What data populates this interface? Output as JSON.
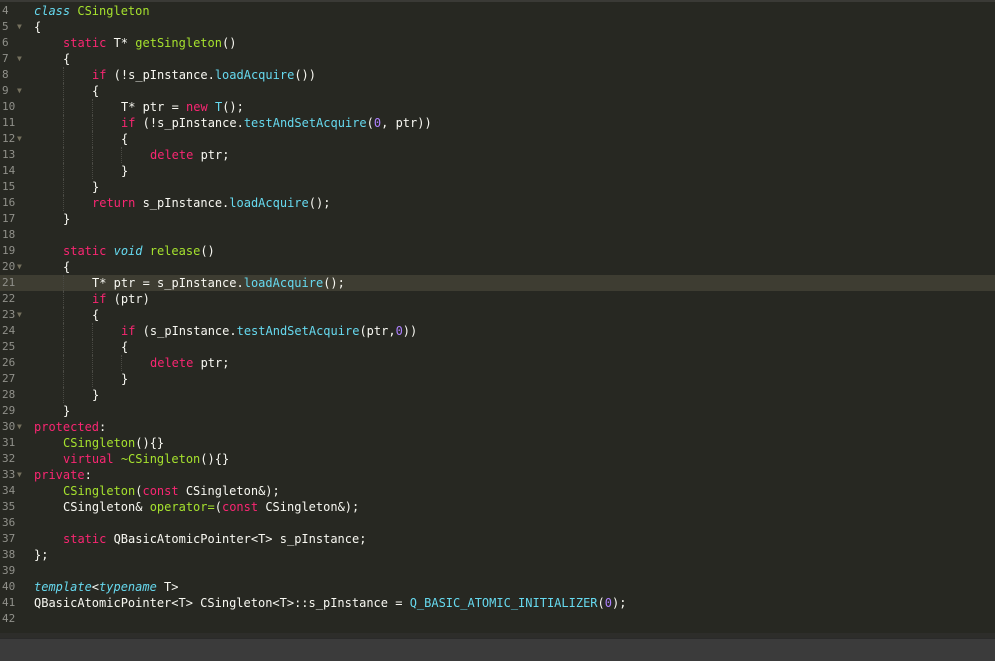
{
  "editor": {
    "theme": "monokai",
    "current_line": "21",
    "colors": {
      "background": "#272822",
      "plain": "#f8f8f2",
      "keyword": "#f92672",
      "type": "#66d9ef",
      "function": "#a6e22e",
      "number": "#ae81ff",
      "line_number": "#90908a"
    },
    "lines": [
      {
        "num": "4",
        "indent": 0,
        "fold": false,
        "tokens": [
          {
            "t": "class",
            "c": "ty"
          },
          {
            "t": " ",
            "c": "pl"
          },
          {
            "t": "CSingleton",
            "c": "cl"
          }
        ]
      },
      {
        "num": "5",
        "indent": 0,
        "fold": true,
        "tokens": [
          {
            "t": "{",
            "c": "pl"
          }
        ]
      },
      {
        "num": "6",
        "indent": 1,
        "fold": false,
        "tokens": [
          {
            "t": "static",
            "c": "kw"
          },
          {
            "t": " T* ",
            "c": "pl"
          },
          {
            "t": "getSingleton",
            "c": "fn"
          },
          {
            "t": "()",
            "c": "pl"
          }
        ]
      },
      {
        "num": "7",
        "indent": 1,
        "fold": true,
        "tokens": [
          {
            "t": "{",
            "c": "pl"
          }
        ]
      },
      {
        "num": "8",
        "indent": 2,
        "fold": false,
        "tokens": [
          {
            "t": "if",
            "c": "kw"
          },
          {
            "t": " (!s_pInstance.",
            "c": "pl"
          },
          {
            "t": "loadAcquire",
            "c": "cn"
          },
          {
            "t": "())",
            "c": "pl"
          }
        ]
      },
      {
        "num": "9",
        "indent": 2,
        "fold": true,
        "tokens": [
          {
            "t": "{",
            "c": "pl"
          }
        ]
      },
      {
        "num": "10",
        "indent": 3,
        "fold": false,
        "tokens": [
          {
            "t": "T* ptr = ",
            "c": "pl"
          },
          {
            "t": "new",
            "c": "kw"
          },
          {
            "t": " ",
            "c": "pl"
          },
          {
            "t": "T",
            "c": "cn"
          },
          {
            "t": "();",
            "c": "pl"
          }
        ]
      },
      {
        "num": "11",
        "indent": 3,
        "fold": false,
        "tokens": [
          {
            "t": "if",
            "c": "kw"
          },
          {
            "t": " (!s_pInstance.",
            "c": "pl"
          },
          {
            "t": "testAndSetAcquire",
            "c": "cn"
          },
          {
            "t": "(",
            "c": "pl"
          },
          {
            "t": "0",
            "c": "nu"
          },
          {
            "t": ", ptr))",
            "c": "pl"
          }
        ]
      },
      {
        "num": "12",
        "indent": 3,
        "fold": true,
        "tokens": [
          {
            "t": "{",
            "c": "pl"
          }
        ]
      },
      {
        "num": "13",
        "indent": 4,
        "fold": false,
        "tokens": [
          {
            "t": "delete",
            "c": "kw"
          },
          {
            "t": " ptr;",
            "c": "pl"
          }
        ]
      },
      {
        "num": "14",
        "indent": 3,
        "fold": false,
        "tokens": [
          {
            "t": "}",
            "c": "pl"
          }
        ]
      },
      {
        "num": "15",
        "indent": 2,
        "fold": false,
        "tokens": [
          {
            "t": "}",
            "c": "pl"
          }
        ]
      },
      {
        "num": "16",
        "indent": 2,
        "fold": false,
        "tokens": [
          {
            "t": "return",
            "c": "kw"
          },
          {
            "t": " s_pInstance.",
            "c": "pl"
          },
          {
            "t": "loadAcquire",
            "c": "cn"
          },
          {
            "t": "();",
            "c": "pl"
          }
        ]
      },
      {
        "num": "17",
        "indent": 1,
        "fold": false,
        "tokens": [
          {
            "t": "}",
            "c": "pl"
          }
        ]
      },
      {
        "num": "18",
        "indent": 0,
        "fold": false,
        "tokens": []
      },
      {
        "num": "19",
        "indent": 1,
        "fold": false,
        "tokens": [
          {
            "t": "static",
            "c": "kw"
          },
          {
            "t": " ",
            "c": "pl"
          },
          {
            "t": "void",
            "c": "ty"
          },
          {
            "t": " ",
            "c": "pl"
          },
          {
            "t": "release",
            "c": "fn"
          },
          {
            "t": "()",
            "c": "pl"
          }
        ]
      },
      {
        "num": "20",
        "indent": 1,
        "fold": true,
        "tokens": [
          {
            "t": "{",
            "c": "pl"
          }
        ]
      },
      {
        "num": "21",
        "indent": 2,
        "fold": false,
        "tokens": [
          {
            "t": "T* ptr = s_pInstance.",
            "c": "pl"
          },
          {
            "t": "loadAcquire",
            "c": "cn"
          },
          {
            "t": "();",
            "c": "pl"
          }
        ]
      },
      {
        "num": "22",
        "indent": 2,
        "fold": false,
        "tokens": [
          {
            "t": "if",
            "c": "kw"
          },
          {
            "t": " (ptr)",
            "c": "pl"
          }
        ]
      },
      {
        "num": "23",
        "indent": 2,
        "fold": true,
        "tokens": [
          {
            "t": "{",
            "c": "pl"
          }
        ]
      },
      {
        "num": "24",
        "indent": 3,
        "fold": false,
        "tokens": [
          {
            "t": "if",
            "c": "kw"
          },
          {
            "t": " (s_pInstance.",
            "c": "pl"
          },
          {
            "t": "testAndSetAcquire",
            "c": "cn"
          },
          {
            "t": "(ptr,",
            "c": "pl"
          },
          {
            "t": "0",
            "c": "nu"
          },
          {
            "t": "))",
            "c": "pl"
          }
        ]
      },
      {
        "num": "25",
        "indent": 3,
        "fold": false,
        "tokens": [
          {
            "t": "{",
            "c": "pl"
          }
        ]
      },
      {
        "num": "26",
        "indent": 4,
        "fold": false,
        "tokens": [
          {
            "t": "delete",
            "c": "kw"
          },
          {
            "t": " ptr;",
            "c": "pl"
          }
        ]
      },
      {
        "num": "27",
        "indent": 3,
        "fold": false,
        "tokens": [
          {
            "t": "}",
            "c": "pl"
          }
        ]
      },
      {
        "num": "28",
        "indent": 2,
        "fold": false,
        "tokens": [
          {
            "t": "}",
            "c": "pl"
          }
        ]
      },
      {
        "num": "29",
        "indent": 1,
        "fold": false,
        "tokens": [
          {
            "t": "}",
            "c": "pl"
          }
        ]
      },
      {
        "num": "30",
        "indent": 0,
        "fold": true,
        "tokens": [
          {
            "t": "protected",
            "c": "kw"
          },
          {
            "t": ":",
            "c": "pl"
          }
        ]
      },
      {
        "num": "31",
        "indent": 1,
        "fold": false,
        "tokens": [
          {
            "t": "CSingleton",
            "c": "fn"
          },
          {
            "t": "(){}",
            "c": "pl"
          }
        ]
      },
      {
        "num": "32",
        "indent": 1,
        "fold": false,
        "tokens": [
          {
            "t": "virtual",
            "c": "kw"
          },
          {
            "t": " ",
            "c": "pl"
          },
          {
            "t": "~CSingleton",
            "c": "fn"
          },
          {
            "t": "(){}",
            "c": "pl"
          }
        ]
      },
      {
        "num": "33",
        "indent": 0,
        "fold": true,
        "tokens": [
          {
            "t": "private",
            "c": "kw"
          },
          {
            "t": ":",
            "c": "pl"
          }
        ]
      },
      {
        "num": "34",
        "indent": 1,
        "fold": false,
        "tokens": [
          {
            "t": "CSingleton",
            "c": "fn"
          },
          {
            "t": "(",
            "c": "pl"
          },
          {
            "t": "const",
            "c": "kw"
          },
          {
            "t": " CSingleton&);",
            "c": "pl"
          }
        ]
      },
      {
        "num": "35",
        "indent": 1,
        "fold": false,
        "tokens": [
          {
            "t": "CSingleton& ",
            "c": "pl"
          },
          {
            "t": "operator=",
            "c": "fn"
          },
          {
            "t": "(",
            "c": "pl"
          },
          {
            "t": "const",
            "c": "kw"
          },
          {
            "t": " CSingleton&);",
            "c": "pl"
          }
        ]
      },
      {
        "num": "36",
        "indent": 0,
        "fold": false,
        "tokens": []
      },
      {
        "num": "37",
        "indent": 1,
        "fold": false,
        "tokens": [
          {
            "t": "static",
            "c": "kw"
          },
          {
            "t": " QBasicAtomicPointer<T> s_pInstance;",
            "c": "pl"
          }
        ]
      },
      {
        "num": "38",
        "indent": 0,
        "fold": false,
        "tokens": [
          {
            "t": "};",
            "c": "pl"
          }
        ]
      },
      {
        "num": "39",
        "indent": 0,
        "fold": false,
        "tokens": []
      },
      {
        "num": "40",
        "indent": 0,
        "fold": false,
        "tokens": [
          {
            "t": "template",
            "c": "ty"
          },
          {
            "t": "<",
            "c": "pl"
          },
          {
            "t": "typename",
            "c": "ty"
          },
          {
            "t": " T>",
            "c": "pl"
          }
        ]
      },
      {
        "num": "41",
        "indent": 0,
        "fold": false,
        "tokens": [
          {
            "t": "QBasicAtomicPointer<T> CSingleton<T>::s_pInstance = ",
            "c": "pl"
          },
          {
            "t": "Q_BASIC_ATOMIC_INITIALIZER",
            "c": "cn"
          },
          {
            "t": "(",
            "c": "pl"
          },
          {
            "t": "0",
            "c": "nu"
          },
          {
            "t": ");",
            "c": "pl"
          }
        ]
      },
      {
        "num": "42",
        "indent": 0,
        "fold": false,
        "tokens": []
      }
    ]
  }
}
